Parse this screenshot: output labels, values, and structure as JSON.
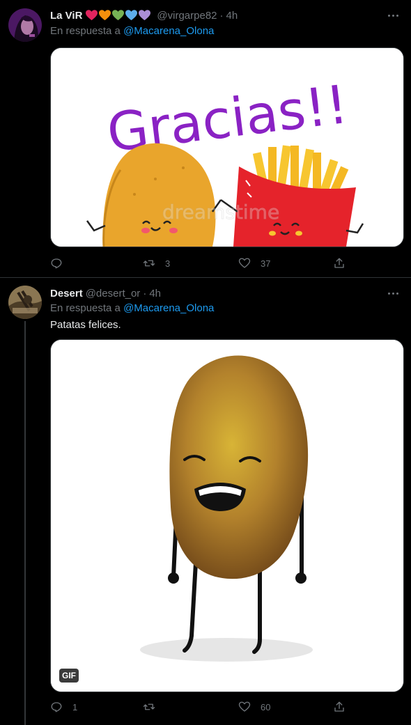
{
  "tweets": [
    {
      "name": "La ViR",
      "hearts": [
        "#e0245e",
        "#f4900c",
        "#77b255",
        "#5dadec",
        "#aa8ed6"
      ],
      "handle": "@virgarpe82",
      "dot": "·",
      "time": "4h",
      "reply_prefix": "En respuesta a",
      "reply_user": "@Macarena_Olona",
      "media": {
        "type": "image",
        "title_text": "Gracias!!",
        "watermark": "dreamstime"
      },
      "actions": {
        "replies": "",
        "retweets": "3",
        "likes": "37"
      }
    },
    {
      "name": "Desert",
      "handle": "@desert_or",
      "dot": "·",
      "time": "4h",
      "reply_prefix": "En respuesta a",
      "reply_user": "@Macarena_Olona",
      "text": "Patatas felices.",
      "media": {
        "type": "gif",
        "badge": "GIF"
      },
      "actions": {
        "replies": "1",
        "retweets": "",
        "likes": "60"
      }
    }
  ],
  "icons": {
    "reply": "reply-icon",
    "retweet": "retweet-icon",
    "like": "heart-icon",
    "share": "share-icon",
    "more": "more-icon"
  },
  "colors": {
    "background": "#000000",
    "link": "#1d9bf0",
    "secondary_text": "#71767b",
    "divider": "#2f3336"
  }
}
